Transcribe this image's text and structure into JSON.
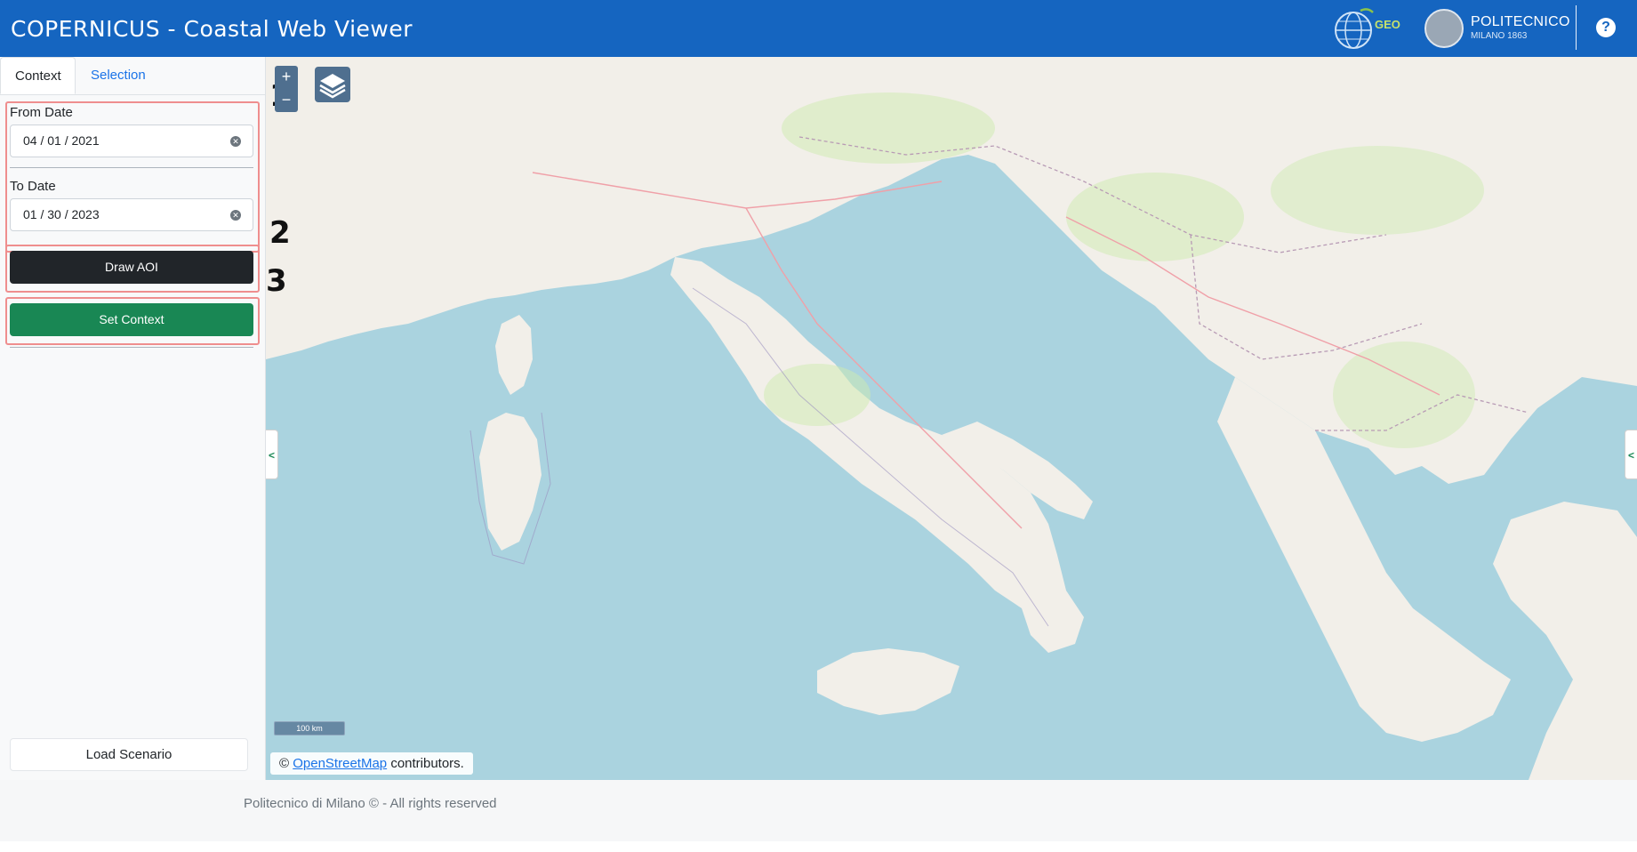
{
  "header": {
    "title": "COPERNICUS - Coastal Web Viewer",
    "geo_logo_text": "GEO",
    "polimi_name": "POLITECNICO",
    "polimi_sub": "MILANO 1863",
    "help_icon": "question-circle-icon",
    "bg_color": "#1565c0"
  },
  "tabs": [
    {
      "label": "Context",
      "active": true
    },
    {
      "label": "Selection",
      "active": false
    }
  ],
  "form": {
    "from_label": "From Date",
    "from_value": "04 / 01 / 2021",
    "to_label": "To Date",
    "to_value": "01 / 30 / 2023",
    "draw_aoi": "Draw AOI",
    "set_context": "Set Context",
    "load_scenario": "Load Scenario"
  },
  "steps": [
    "1",
    "2",
    "3"
  ],
  "map": {
    "zoom_in": "+",
    "zoom_out": "−",
    "layers_icon": "layers-icon",
    "collapse_left": "<",
    "collapse_right": "<",
    "scale_label": "100 km",
    "attribution_prefix": "©",
    "attribution_link": "OpenStreetMap",
    "attribution_suffix": "contributors.",
    "water_color": "#aad3df",
    "land_color": "#f2efe9"
  },
  "footer": {
    "text": "Politecnico di Milano © - All rights reserved"
  }
}
